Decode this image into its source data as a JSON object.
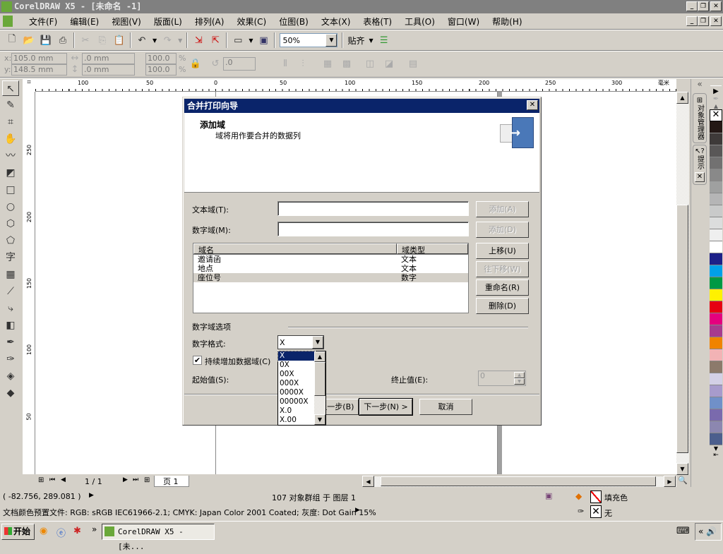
{
  "window": {
    "title": "CorelDRAW X5 - [未命名 -1]"
  },
  "menu": [
    "文件(F)",
    "编辑(E)",
    "视图(V)",
    "版面(L)",
    "排列(A)",
    "效果(C)",
    "位图(B)",
    "文本(X)",
    "表格(T)",
    "工具(O)",
    "窗口(W)",
    "帮助(H)"
  ],
  "toolbar": {
    "zoom_value": "50%",
    "snap_label": "贴齐"
  },
  "property_bar": {
    "x_label": "x:",
    "y_label": "y:",
    "x_value": "105.0 mm",
    "y_value": "148.5 mm",
    "w_value": ".0 mm",
    "h_value": ".0 mm",
    "scale_x": "100.0",
    "scale_y": "100.0",
    "pct": "%",
    "rotation": ".0"
  },
  "rulers": {
    "unit": "毫米",
    "top": [
      "100",
      "50",
      "0",
      "50",
      "100",
      "150",
      "200",
      "250",
      "300"
    ],
    "left": [
      "250",
      "200",
      "150",
      "100",
      "50"
    ]
  },
  "dockers": [
    "对象管理器",
    "提示"
  ],
  "palette": [
    "#231815",
    "#3e3a39",
    "#595757",
    "#727171",
    "#898989",
    "#9fa0a0",
    "#b5b5b6",
    "#c9caca",
    "#dcdddd",
    "#efefef",
    "#ffffff",
    "#1d2088",
    "#00a0e9",
    "#009944",
    "#fff100",
    "#e60012",
    "#e4007f",
    "#a73b8f",
    "#f08300",
    "#f2b3b5",
    "#8c7a6b",
    "#d3d0e6",
    "#a79bcc",
    "#7090c8",
    "#7a6aad",
    "#8c87b0",
    "#4c5f8d"
  ],
  "nav": {
    "page_count": "1 / 1",
    "page_tab": "页 1"
  },
  "status": {
    "coords": "( -82.756, 289.081 )",
    "selection": "107 对象群组 于 图层 1",
    "fill_label": "填充色",
    "outline_label": "无",
    "color_profile": "文档颜色预置文件: RGB: sRGB IEC61966-2.1; CMYK: Japan Color 2001 Coated; 灰度: Dot Gain 15%"
  },
  "taskbar": {
    "start": "开始",
    "task": "CorelDRAW X5 - [未..."
  },
  "dialog": {
    "title": "合并打印向导",
    "heading": "添加域",
    "subheading": "域将用作要合并的数据列",
    "text_field_label": "文本域(T):",
    "number_field_label": "数字域(M):",
    "text_field_value": "",
    "number_field_value": "",
    "add_text_button": "添加(A)",
    "add_number_button": "添加(D)",
    "columns": [
      "域名",
      "域类型"
    ],
    "rows": [
      {
        "name": "邀请函",
        "type": "文本"
      },
      {
        "name": "地点",
        "type": "文本"
      },
      {
        "name": "座位号",
        "type": "数字"
      }
    ],
    "move_up": "上移(U)",
    "move_down": "往下移(W)",
    "rename": "重命名(R)",
    "delete": "删除(D)",
    "number_options": "数字域选项",
    "number_format_label": "数字格式:",
    "number_format_value": "X",
    "format_options": [
      "X",
      "0X",
      "00X",
      "000X",
      "0000X",
      "00000X",
      "X.0",
      "X.00"
    ],
    "continuous_label": "持续增加数据域(C)",
    "continuous_checked": true,
    "start_label": "起始值(S):",
    "end_label": "终止值(E):",
    "end_value": "0",
    "back_button": "< 上一步(B)",
    "next_button": "下一步(N) >",
    "cancel_button": "取消"
  }
}
